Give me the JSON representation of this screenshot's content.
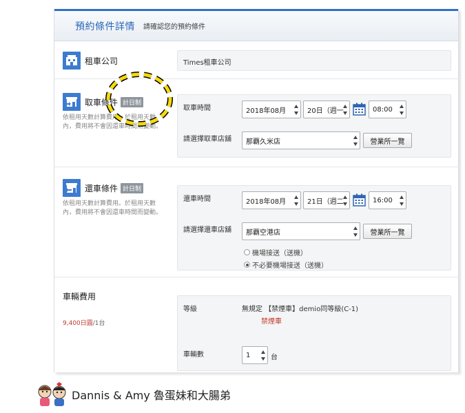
{
  "header": {
    "title": "預約條件詳情",
    "subtitle": "請確認您的預約條件"
  },
  "company": {
    "label": "租車公司",
    "value": "Times租車公司",
    "icon": "building-icon"
  },
  "pickup": {
    "label": "取車條件",
    "badge": "計日制",
    "note": "依租用天數計算費用。於租用天數內，費用將不會因還車時間而變動。",
    "time_label": "取車時間",
    "month": "2018年08月",
    "day": "20日（週一",
    "hour": "08:00",
    "store_label": "請選擇取車店舖",
    "store": "那覇久米店",
    "store_list_button": "營業所一覽"
  },
  "return": {
    "label": "還車條件",
    "badge": "計日制",
    "note": "依租用天數計算費用。於租用天數內，費用將不會因還車時間而變動。",
    "time_label": "還車時間",
    "month": "2018年08月",
    "day": "21日（週二",
    "hour": "16:00",
    "store_label": "請選擇還車店舖",
    "store": "那覇空港店",
    "store_list_button": "營業所一覽",
    "options": [
      {
        "label": "機場接送（送機）",
        "checked": false
      },
      {
        "label": "不必要機場接送（送機）",
        "checked": true
      }
    ]
  },
  "vehicle": {
    "label": "車輛費用",
    "price": "9,400日圓",
    "price_unit": "/1台",
    "grade_label": "等級",
    "grade_value": "無規定 【禁煙車】demio同等級(C-1)",
    "smoking": "禁煙車",
    "count_label": "車輛數",
    "count": "1",
    "count_unit": "台"
  },
  "footer": {
    "text": "Dannis & Amy 魯蛋妹和大腸弟"
  },
  "colors": {
    "accent": "#2f71c8",
    "icon_bg": "#3d7bd0",
    "price": "#c0392b",
    "highlight": "#f5d90a"
  }
}
